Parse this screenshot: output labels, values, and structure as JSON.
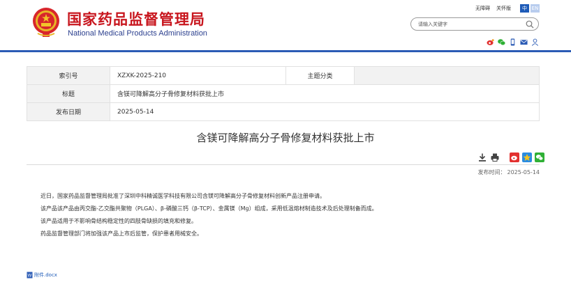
{
  "header": {
    "title_cn": "国家药品监督管理局",
    "title_en": "National Medical Products Administration",
    "links": [
      "无障碍",
      "关怀版"
    ],
    "lang_active": "中",
    "lang_inactive": "EN",
    "search_placeholder": "请输入关键字",
    "socials": [
      "weibo-icon",
      "wechat-icon",
      "mobile-icon",
      "mail-icon",
      "user-icon"
    ]
  },
  "meta": {
    "index_key": "索引号",
    "index_value": "XZXK-2025-210",
    "subject_key": "主题分类",
    "subject_value": "",
    "title_key": "标题",
    "title_value": "含镁可降解高分子骨修复材料获批上市",
    "date_key": "发布日期",
    "date_value": "2025-05-14"
  },
  "article": {
    "title": "含镁可降解高分子骨修复材料获批上市",
    "publish_label": "发布时间：",
    "publish_date": "2025-05-14",
    "paragraphs": [
      "近日，国家药品监督管理局批准了深圳中科精诚医学科技有限公司含镁可降解高分子骨修复材料创新产品注册申请。",
      "该产品该产品由丙交酯-乙交酯共聚物（PLGA）、β-磷酸三钙（β-TCP）、金属镁（Mg）组成，采用低温熔材制造技术及后处理制备而成。",
      "该产品适用于不影响骨结构稳定性的四肢骨缺损的填充和修复。",
      "药品监督管理部门将加强该产品上市后监管，保护患者用械安全。"
    ],
    "attachment": "附件.docx"
  },
  "colors": {
    "brand_red": "#c8161e",
    "brand_blue": "#2b5bb5",
    "link_blue": "#1e5bb8"
  }
}
